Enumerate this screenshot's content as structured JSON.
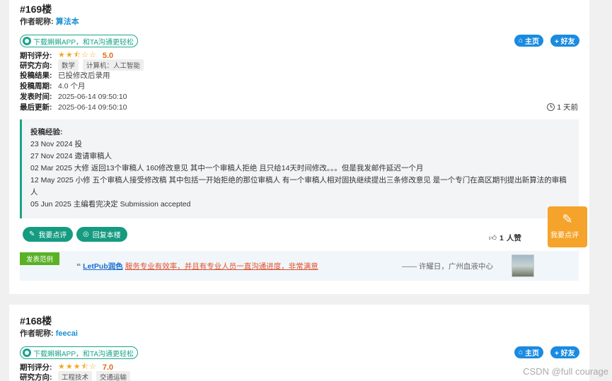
{
  "posts": [
    {
      "floor": "#169楼",
      "author_label": "作者昵称:",
      "author_name": "算法本",
      "app_badge": "下载蝌蝌APP，和TA沟通更轻松",
      "home_label": "主页",
      "friend_label": "+ 好友",
      "rating_label": "期刊评分:",
      "rating_value": 2.5,
      "rating_stars": "★★⯪☆☆",
      "rating_score": "5.0",
      "field_label": "研究方向:",
      "field_tags": [
        "数学",
        "计算机：人工智能"
      ],
      "result_label": "投稿结果:",
      "result_value": "已投修改后录用",
      "cycle_label": "投稿周期:",
      "cycle_value": "4.0 个月",
      "posted_label": "发表时间:",
      "posted_value": "2025-06-14 09:50:10",
      "updated_label": "最后更新:",
      "updated_value": "2025-06-14 09:50:10",
      "time_ago": "1 天前",
      "experience_title": "投稿经验:",
      "experience_lines": [
        "23 Nov 2024 投",
        "27 Nov 2024 邀请审稿人",
        "02 Mar 2025 大修 返回13个审稿人 160修改意见 其中一个审稿人拒绝 且只给14天时间修改。。。但是我发邮件延迟一个月",
        "12 May 2025 小修 五个审稿人接受修改稿 其中包括一开始拒绝的那位审稿人 有一个审稿人相对固执继续提出三条修改意见 是一个专门在高区期刊提出新算法的审稿人",
        "05 Jun 2025 主编看完决定 Submission accepted"
      ],
      "comment_button": "我要点评",
      "reply_button": "回复本楼",
      "likes_count": "1",
      "likes_unit": "人赞"
    },
    {
      "floor": "#168楼",
      "author_label": "作者昵称:",
      "author_name": "feecai",
      "app_badge": "下载蝌蝌APP，和TA沟通更轻松",
      "home_label": "主页",
      "friend_label": "+ 好友",
      "rating_label": "期刊评分:",
      "rating_value": 3.5,
      "rating_stars": "★★★⯪☆",
      "rating_score": "7.0",
      "field_label": "研究方向:",
      "field_tags": [
        "工程技术",
        "交通运输"
      ]
    }
  ],
  "testimonial": {
    "tag": "发表范例",
    "brand": "LetPub润色",
    "message": "服务专业有效率，并且有专业人员一直沟通进度，非常满意",
    "author": "—— 许耀日，广州血液中心"
  },
  "float_button": "我要点评",
  "watermark": "CSDN @full courage",
  "colors": {
    "accent_green": "#159b80",
    "accent_blue": "#1a8be0",
    "star": "#f5a623",
    "float_orange": "#f5a32a"
  }
}
